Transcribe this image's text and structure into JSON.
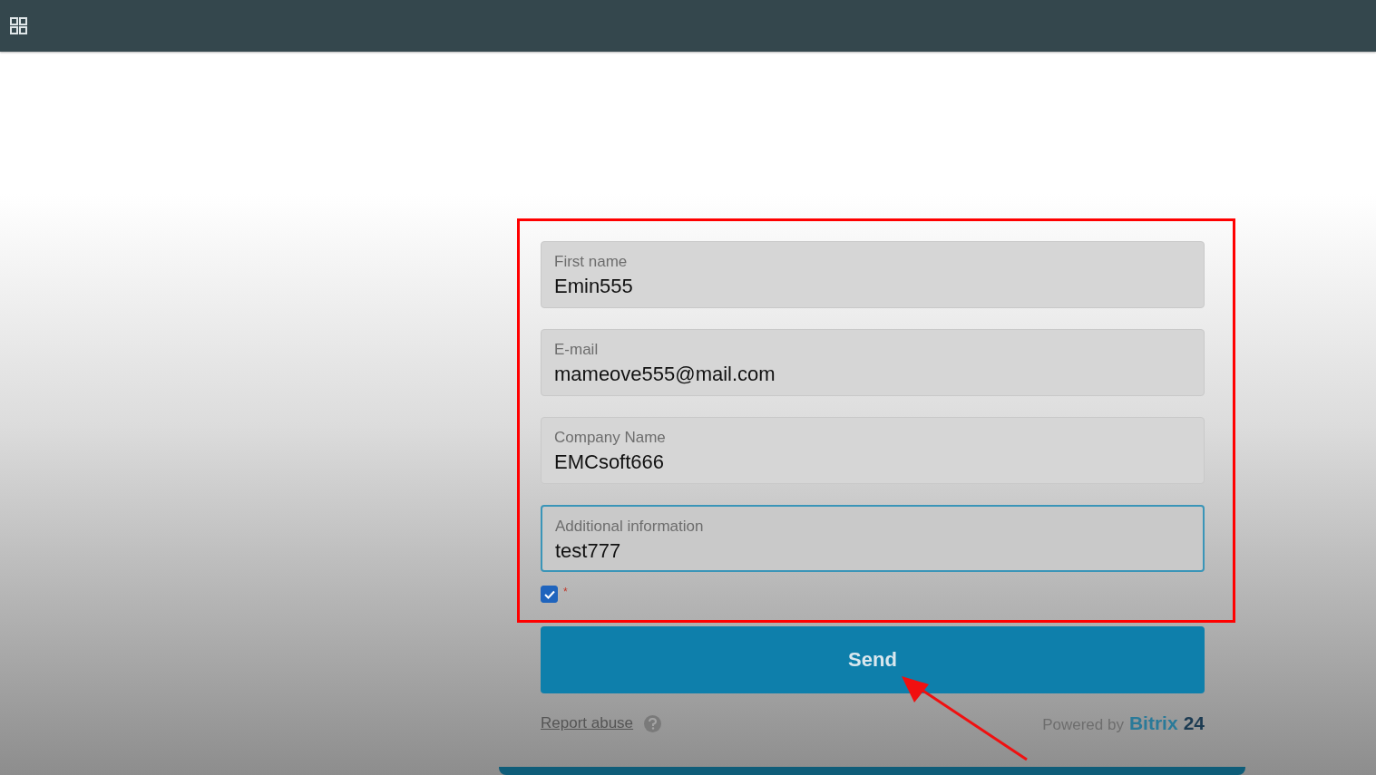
{
  "form": {
    "fields": [
      {
        "label": "First name",
        "value": "Emin555",
        "focused": false
      },
      {
        "label": "E-mail",
        "value": "mameove555@mail.com",
        "focused": false
      },
      {
        "label": "Company Name",
        "value": "EMCsoft666",
        "focused": false
      },
      {
        "label": "Additional information",
        "value": "test777",
        "focused": true
      }
    ],
    "consent": {
      "checked": true,
      "required_mark": "*"
    },
    "submit": "Send",
    "report_abuse": "Report abuse",
    "powered_by": "Powered by",
    "brand_name": "Bitrix",
    "brand_number": "24"
  }
}
